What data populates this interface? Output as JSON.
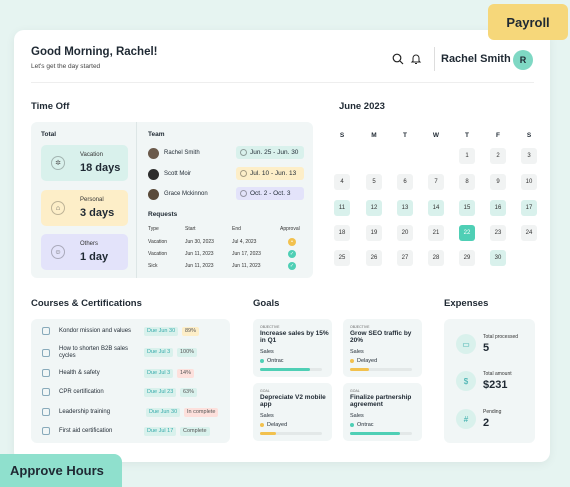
{
  "badges": {
    "payroll": "Payroll",
    "approve": "Approve Hours"
  },
  "header": {
    "greeting": "Good Morning, Rachel!",
    "subtitle": "Let's get the day started",
    "user_name": "Rachel Smith",
    "avatar_initial": "R"
  },
  "time_off": {
    "title": "Time Off",
    "total_label": "Total",
    "team_label": "Team",
    "requests_label": "Requests",
    "tiles": [
      {
        "label": "Vacation",
        "value": "18 days",
        "color": "#d9f1ec"
      },
      {
        "label": "Personal",
        "value": "3 days",
        "color": "#fdeec8"
      },
      {
        "label": "Others",
        "value": "1 day",
        "color": "#e3e3fa"
      }
    ],
    "team": [
      {
        "name": "Rachel Smith",
        "dates": "Jun. 25 - Jun. 30",
        "color": "#d9f1ec"
      },
      {
        "name": "Scott Moir",
        "dates": "Jul. 10  -  Jun. 13",
        "color": "#fdeec8"
      },
      {
        "name": "Grace Mckinnon",
        "dates": "Oct. 2  -  Oct. 3",
        "color": "#e3e3fa"
      }
    ],
    "req_headers": [
      "Type",
      "Start",
      "End",
      "Approval"
    ],
    "requests": [
      {
        "type": "Vacation",
        "start": "Jun 30, 2023",
        "end": "Jul 4, 2023",
        "status": "pending"
      },
      {
        "type": "Vacation",
        "start": "Jun 11, 2023",
        "end": "Jun 17, 2023",
        "status": "approved"
      },
      {
        "type": "Sick",
        "start": "Jun 11, 2023",
        "end": "Jun 11, 2023",
        "status": "approved"
      }
    ]
  },
  "calendar": {
    "title": "June 2023",
    "dow": [
      "S",
      "M",
      "T",
      "W",
      "T",
      "F",
      "S"
    ],
    "weeks": [
      [
        "",
        "",
        "",
        "",
        "1",
        "2",
        "3"
      ],
      [
        "4",
        "5",
        "6",
        "7",
        "8",
        "9",
        "10"
      ],
      [
        "11",
        "12",
        "13",
        "14",
        "15",
        "16",
        "17"
      ],
      [
        "18",
        "19",
        "20",
        "21",
        "22",
        "23",
        "24"
      ],
      [
        "25",
        "26",
        "27",
        "28",
        "29",
        "30",
        ""
      ]
    ],
    "tinted": [
      "11",
      "12",
      "13",
      "14",
      "15",
      "16",
      "17",
      "30"
    ],
    "selected": "22"
  },
  "courses": {
    "title": "Courses & Certifications",
    "items": [
      {
        "name": "Kondor mission and values",
        "due": "Due Jun 30",
        "status": "89%",
        "status_color": "#fdeec8"
      },
      {
        "name": "How to shorten B2B sales cycles",
        "due": "Due Jul 3",
        "status": "100%",
        "status_color": "#d9f1ec"
      },
      {
        "name": "Health & safety",
        "due": "Due Jul 3",
        "status": "14%",
        "status_color": "#fde0dc"
      },
      {
        "name": "CPR certification",
        "due": "Due Jul 23",
        "status": "63%",
        "status_color": "#d9f1ec"
      },
      {
        "name": "Leadership training",
        "due": "Due Jun 30",
        "status": "In complete",
        "status_color": "#fde0dc"
      },
      {
        "name": "First aid certification",
        "due": "Due Jul 17",
        "status": "Complete",
        "status_color": "#d9f1ec"
      }
    ]
  },
  "goals": {
    "title": "Goals",
    "items": [
      {
        "label": "OBJECTIVE",
        "title": "Increase sales by 15% in Q1",
        "dept": "Sales",
        "status": "Ontrac",
        "status_color": "#4fcfb5",
        "progress": 0.8
      },
      {
        "label": "OBJECTIVE",
        "title": "Grow SEO traffic by 20%",
        "dept": "Sales",
        "status": "Delayed",
        "status_color": "#f2c14e",
        "progress": 0.3
      },
      {
        "label": "GOAL",
        "title": "Depreciate V2 mobile app",
        "dept": "Sales",
        "status": "Delayed",
        "status_color": "#f2c14e",
        "progress": 0.25
      },
      {
        "label": "GOAL",
        "title": "Finalize partnership agreement",
        "dept": "Sales",
        "status": "Ontrac",
        "status_color": "#4fcfb5",
        "progress": 0.8
      }
    ]
  },
  "expenses": {
    "title": "Expenses",
    "items": [
      {
        "label": "Total processed",
        "value": "5",
        "icon": "card-icon"
      },
      {
        "label": "Total amount",
        "value": "$231",
        "icon": "dollar-icon"
      },
      {
        "label": "Pending",
        "value": "2",
        "icon": "hash-icon"
      }
    ]
  }
}
